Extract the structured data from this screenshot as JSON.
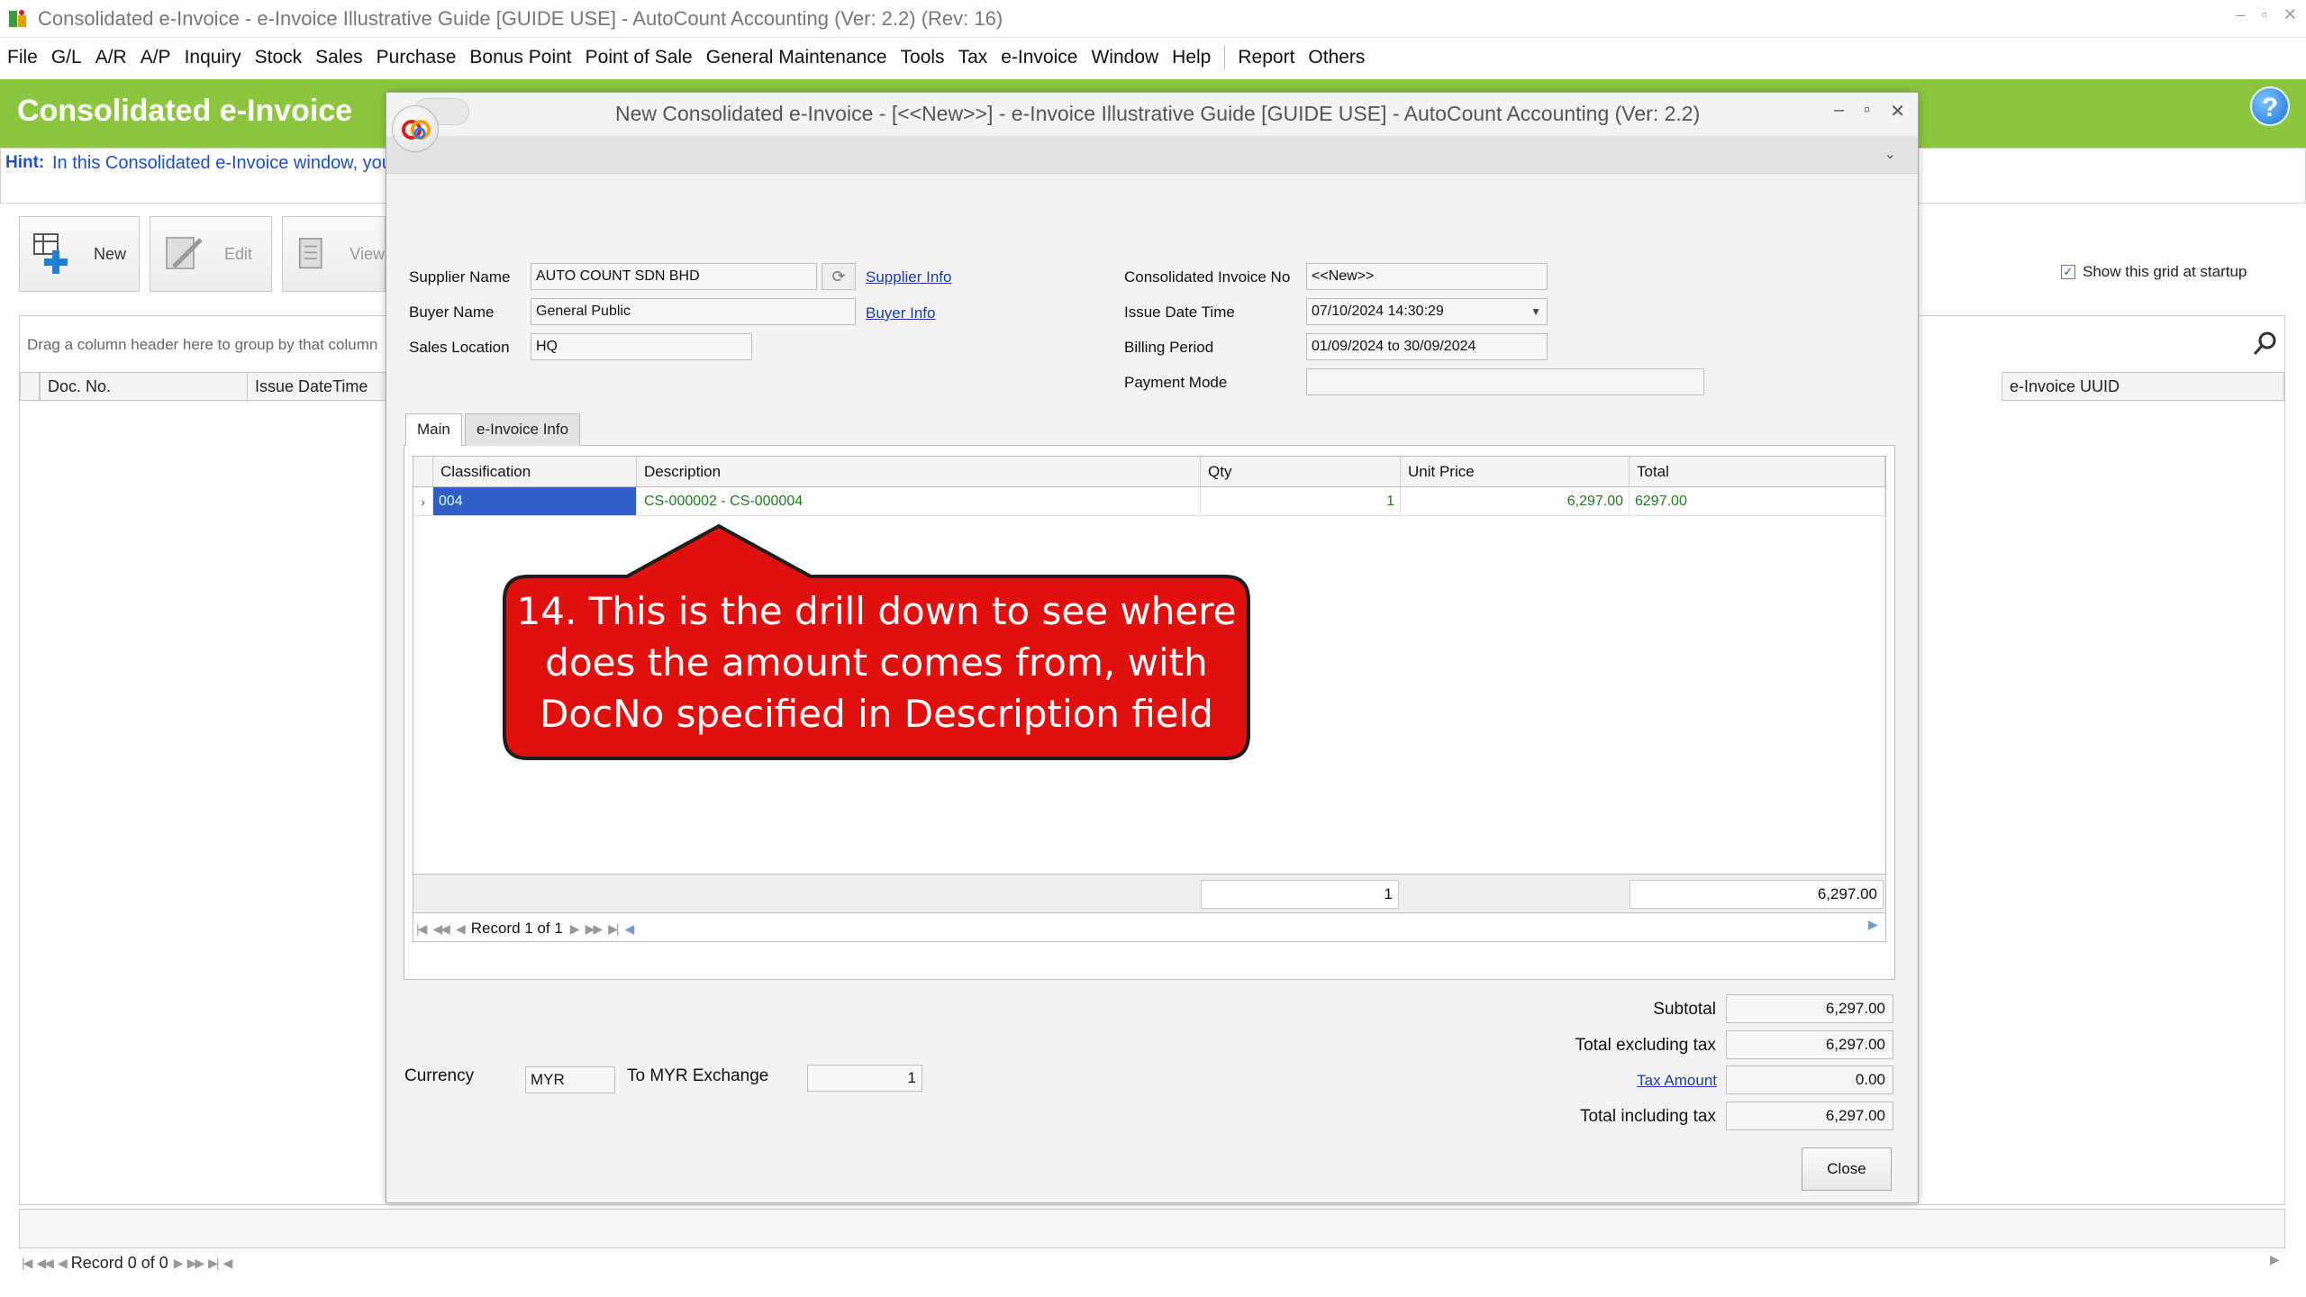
{
  "app": {
    "title": "Consolidated e-Invoice - e-Invoice Illustrative Guide [GUIDE USE] - AutoCount Accounting (Ver: 2.2) (Rev: 16)"
  },
  "menu": [
    "File",
    "G/L",
    "A/R",
    "A/P",
    "Inquiry",
    "Stock",
    "Sales",
    "Purchase",
    "Bonus Point",
    "Point of Sale",
    "General Maintenance",
    "Tools",
    "Tax",
    "e-Invoice",
    "Window",
    "Help",
    "Report",
    "Others"
  ],
  "header": {
    "title": "Consolidated e-Invoice",
    "hint_label": "Hint:",
    "hint_text": "In this Consolidated e-Invoice window, you"
  },
  "toolbar": {
    "new_label": "New",
    "edit_label": "Edit",
    "view_label": "View"
  },
  "background_grid": {
    "group_hint": "Drag a column header here to group by that column",
    "show_grid_label": "Show this grid at startup",
    "columns": [
      "Doc. No.",
      "Issue DateTime",
      "e-Invoice UUID"
    ],
    "record_text": "Record 0 of 0"
  },
  "dialog": {
    "title": "New Consolidated e-Invoice - [<<New>>] - e-Invoice Illustrative Guide [GUIDE USE] - AutoCount Accounting (Ver: 2.2)",
    "fields": {
      "supplier_name_label": "Supplier Name",
      "supplier_name": "AUTO COUNT SDN BHD",
      "supplier_info_link": "Supplier Info",
      "buyer_name_label": "Buyer Name",
      "buyer_name": "General Public",
      "buyer_info_link": "Buyer Info",
      "sales_location_label": "Sales Location",
      "sales_location": "HQ",
      "consolidated_no_label": "Consolidated Invoice No",
      "consolidated_no": "<<New>>",
      "issue_datetime_label": "Issue Date Time",
      "issue_datetime": "07/10/2024 14:30:29",
      "billing_period_label": "Billing Period",
      "billing_period": "01/09/2024 to 30/09/2024",
      "payment_mode_label": "Payment Mode",
      "payment_mode": ""
    },
    "tabs": [
      "Main",
      "e-Invoice Info"
    ],
    "grid": {
      "columns": [
        "Classification",
        "Description",
        "Qty",
        "Unit Price",
        "Total"
      ],
      "rows": [
        {
          "classification": "004",
          "description": "CS-000002 - CS-000004",
          "qty": "1",
          "unit_price": "6,297.00",
          "total": "6297.00"
        }
      ],
      "footer_qty": "1",
      "footer_total": "6,297.00",
      "record_text": "Record 1 of 1"
    },
    "currency_label": "Currency",
    "currency": "MYR",
    "exchange_label": "To MYR Exchange",
    "exchange_rate": "1",
    "totals": {
      "subtotal_label": "Subtotal",
      "subtotal": "6,297.00",
      "excl_tax_label": "Total excluding tax",
      "excl_tax": "6,297.00",
      "tax_amount_label": "Tax Amount",
      "tax_amount": "0.00",
      "incl_tax_label": "Total including tax",
      "incl_tax": "6,297.00"
    },
    "close_label": "Close"
  },
  "annotation": {
    "text": "14. This is the drill down to see where does the amount comes from, with DocNo specified in Description field",
    "color": "#e0100f"
  }
}
